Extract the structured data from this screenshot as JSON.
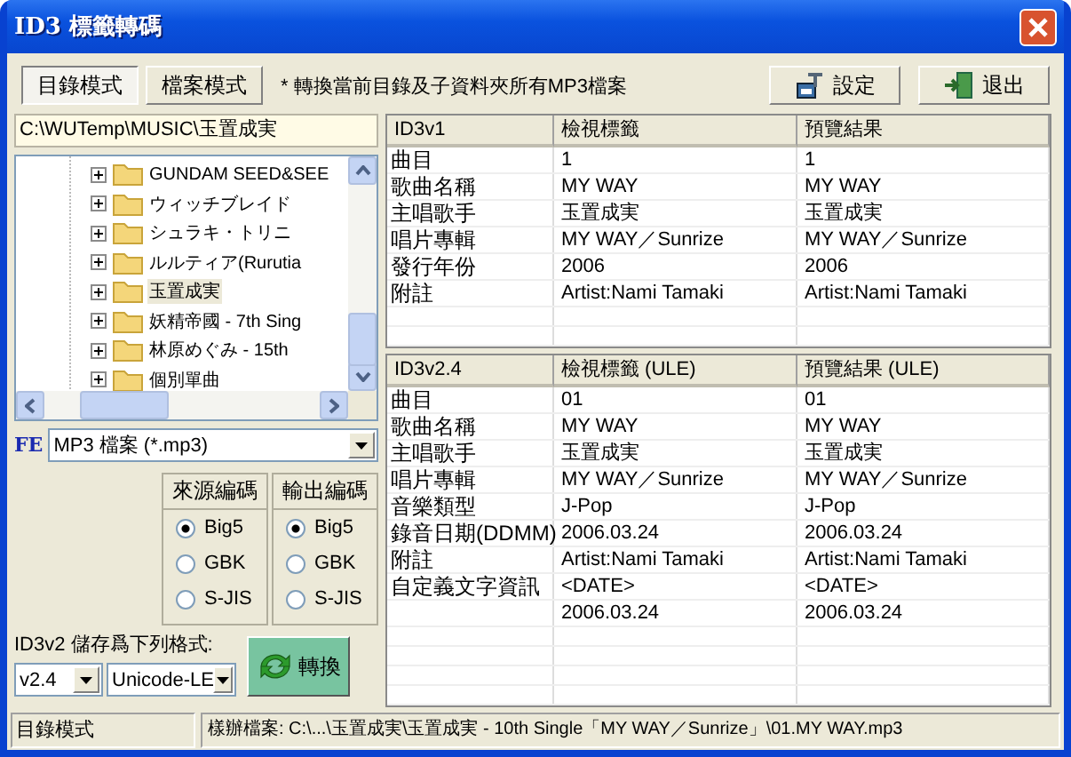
{
  "window": {
    "title": "ID3 標籤轉碼"
  },
  "mode_tabs": [
    {
      "label": "目錄模式",
      "selected": true
    },
    {
      "label": "檔案模式",
      "selected": false
    }
  ],
  "note": "* 轉換當前目錄及子資料夾所有MP3檔案",
  "buttons": [
    {
      "kind": "settings",
      "label": "設定"
    },
    {
      "kind": "exit",
      "label": "退出"
    }
  ],
  "path": "C:\\WUTemp\\MUSIC\\玉置成実",
  "tree": {
    "items": [
      {
        "label": "GUNDAM SEED&SEE",
        "expanded": false,
        "selected": false
      },
      {
        "label": "ウィッチブレイド",
        "expanded": false,
        "selected": false
      },
      {
        "label": "シュラキ・トリニ",
        "expanded": false,
        "selected": false
      },
      {
        "label": "ルルティア(Rurutia",
        "expanded": false,
        "selected": false
      },
      {
        "label": "玉置成実",
        "expanded": false,
        "selected": true
      },
      {
        "label": "妖精帝國 - 7th Sing",
        "expanded": false,
        "selected": false
      },
      {
        "label": "林原めぐみ - 15th",
        "expanded": false,
        "selected": false
      },
      {
        "label": "個別單曲",
        "expanded": false,
        "selected": false
      }
    ]
  },
  "filter": {
    "icon_text": "FE",
    "value": "MP3 檔案 (*.mp3)"
  },
  "encodings": [
    {
      "title": "來源編碼",
      "options": [
        {
          "label": "Big5",
          "selected": true
        },
        {
          "label": "GBK",
          "selected": false
        },
        {
          "label": "S-JIS",
          "selected": false
        }
      ]
    },
    {
      "title": "輸出編碼",
      "options": [
        {
          "label": "Big5",
          "selected": true
        },
        {
          "label": "GBK",
          "selected": false
        },
        {
          "label": "S-JIS",
          "selected": false
        }
      ]
    }
  ],
  "id3v2_format": {
    "label": "ID3v2 儲存爲下列格式:",
    "version": "v2.4",
    "encoding": "Unicode-LE"
  },
  "convert_button": "轉換",
  "tables": [
    {
      "columns": [
        "ID3v1",
        "檢視標籤",
        "預覽結果"
      ],
      "rows": [
        {
          "label": "曲目",
          "view": "1",
          "preview": "1"
        },
        {
          "label": "歌曲名稱",
          "view": "MY WAY",
          "preview": "MY WAY"
        },
        {
          "label": "主唱歌手",
          "view": "玉置成実",
          "preview": "玉置成実"
        },
        {
          "label": "唱片專輯",
          "view": "MY WAY／Sunrize",
          "preview": "MY WAY／Sunrize"
        },
        {
          "label": "發行年份",
          "view": "2006",
          "preview": "2006"
        },
        {
          "label": "附註",
          "view": "Artist:Nami Tamaki",
          "preview": "Artist:Nami Tamaki"
        }
      ]
    },
    {
      "columns": [
        "ID3v2.4",
        "檢視標籤 (ULE)",
        "預覽結果 (ULE)"
      ],
      "rows": [
        {
          "label": "曲目",
          "view": "01",
          "preview": "01"
        },
        {
          "label": "歌曲名稱",
          "view": "MY WAY",
          "preview": "MY WAY"
        },
        {
          "label": "主唱歌手",
          "view": "玉置成実",
          "preview": "玉置成実"
        },
        {
          "label": "唱片專輯",
          "view": "MY WAY／Sunrize",
          "preview": "MY WAY／Sunrize"
        },
        {
          "label": "音樂類型",
          "view": "J-Pop",
          "preview": "J-Pop"
        },
        {
          "label": "錄音日期(DDMM)",
          "view": "2006.03.24",
          "preview": "2006.03.24"
        },
        {
          "label": "附註",
          "view": "Artist:Nami Tamaki",
          "preview": "Artist:Nami Tamaki"
        },
        {
          "label": "自定義文字資訊",
          "view": "<DATE>",
          "preview": "<DATE>"
        },
        {
          "view": "2006.03.24",
          "preview": "2006.03.24"
        }
      ]
    }
  ],
  "status_bar": {
    "mode": "目錄模式",
    "file": "樣辦檔案: C:\\...\\玉置成実\\玉置成実 - 10th Single「MY WAY／Sunrize」\\01.MY WAY.mp3"
  }
}
